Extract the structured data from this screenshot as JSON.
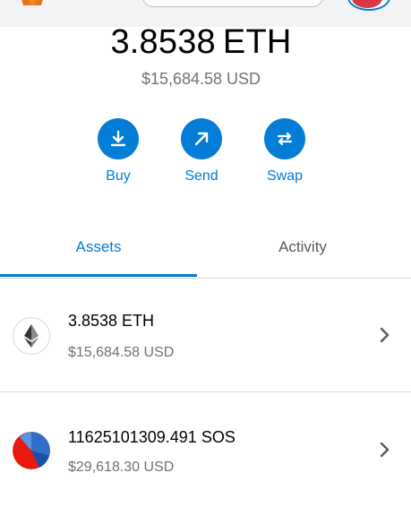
{
  "balance": {
    "amount": "3.8538",
    "unit": "ETH",
    "fiat": "$15,684.58 USD"
  },
  "actions": [
    {
      "label": "Buy",
      "icon": "download-icon"
    },
    {
      "label": "Send",
      "icon": "arrow-up-right-icon"
    },
    {
      "label": "Swap",
      "icon": "swap-icon"
    }
  ],
  "tabs": [
    {
      "label": "Assets",
      "active": true
    },
    {
      "label": "Activity",
      "active": false
    }
  ],
  "assets": [
    {
      "amount": "3.8538 ETH",
      "fiat": "$15,684.58 USD",
      "icon": "ethereum-icon"
    },
    {
      "amount": "11625101309.491 SOS",
      "fiat": "$29,618.30 USD",
      "icon": "sos-token-icon"
    }
  ],
  "colors": {
    "accent": "#037dd6",
    "muted": "#6a737d",
    "divider": "#d6d9dc"
  }
}
